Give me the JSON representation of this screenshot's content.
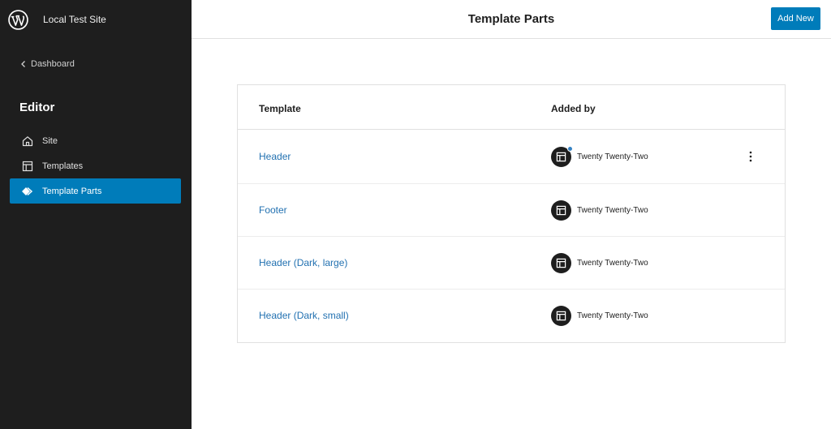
{
  "site": {
    "title": "Local Test Site",
    "logo_icon": "wordpress-logo-icon"
  },
  "sidebar": {
    "back_label": "Dashboard",
    "heading": "Editor",
    "items": [
      {
        "label": "Site",
        "icon": "home-icon",
        "active": false
      },
      {
        "label": "Templates",
        "icon": "layout-icon",
        "active": false
      },
      {
        "label": "Template Parts",
        "icon": "symbol-filled-icon",
        "active": true
      }
    ]
  },
  "header": {
    "title": "Template Parts",
    "add_new_label": "Add New"
  },
  "table": {
    "columns": [
      "Template",
      "Added by"
    ],
    "rows": [
      {
        "name": "Header",
        "author": "Twenty Twenty-Two",
        "has_dot": true,
        "has_menu": true
      },
      {
        "name": "Footer",
        "author": "Twenty Twenty-Two",
        "has_dot": false,
        "has_menu": false
      },
      {
        "name": "Header (Dark, large)",
        "author": "Twenty Twenty-Two",
        "has_dot": false,
        "has_menu": false
      },
      {
        "name": "Header (Dark, small)",
        "author": "Twenty Twenty-Two",
        "has_dot": false,
        "has_menu": false
      }
    ]
  },
  "colors": {
    "accent": "#007cba",
    "link": "#2271b1",
    "sidebar_bg": "#1e1e1e"
  }
}
